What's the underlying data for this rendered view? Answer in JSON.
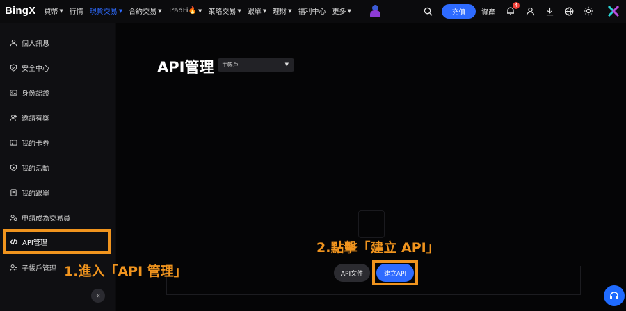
{
  "brand": {
    "logo": "BingX"
  },
  "nav": {
    "items": [
      {
        "label": "買幣",
        "caret": true,
        "active": false
      },
      {
        "label": "行情",
        "caret": false,
        "active": false
      },
      {
        "label": "現貨交易",
        "caret": true,
        "active": true
      },
      {
        "label": "合約交易",
        "caret": true,
        "active": false
      },
      {
        "label": "TradFi🔥",
        "caret": true,
        "active": false
      },
      {
        "label": "策略交易",
        "caret": true,
        "active": false
      },
      {
        "label": "跟單",
        "caret": true,
        "active": false
      },
      {
        "label": "理財",
        "caret": true,
        "active": false
      },
      {
        "label": "福利中心",
        "caret": false,
        "active": false
      },
      {
        "label": "更多",
        "caret": true,
        "active": false
      }
    ],
    "deposit_label": "充值",
    "assets_label": "資產",
    "notification_count": "4"
  },
  "sidebar": {
    "items": [
      {
        "label": "個人訊息",
        "icon": "user-icon"
      },
      {
        "label": "安全中心",
        "icon": "shield-icon"
      },
      {
        "label": "身份認證",
        "icon": "id-card-icon"
      },
      {
        "label": "邀請有獎",
        "icon": "invite-icon"
      },
      {
        "label": "我的卡券",
        "icon": "coupon-icon"
      },
      {
        "label": "我的活動",
        "icon": "activity-icon"
      },
      {
        "label": "我的跟單",
        "icon": "copy-trade-icon"
      },
      {
        "label": "申請成為交易員",
        "icon": "trader-icon"
      },
      {
        "label": "API管理",
        "icon": "code-icon"
      },
      {
        "label": "子帳戶管理",
        "icon": "sub-account-icon"
      }
    ],
    "collapse_label": "«"
  },
  "main": {
    "title": "API管理",
    "account_select": "主帳戶",
    "doc_button": "API文件",
    "create_button": "建立API"
  },
  "annotations": {
    "step1": "1.進入「API 管理」",
    "step2": "2.點擊「建立 API」"
  },
  "colors": {
    "accent": "#2e6bff",
    "highlight": "#f0941e",
    "background": "#0b0b0d"
  }
}
